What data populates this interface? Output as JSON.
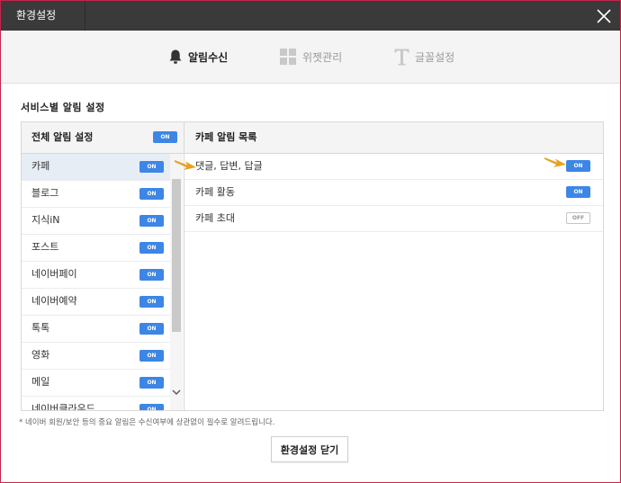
{
  "window": {
    "title": "환경설정"
  },
  "tabs": [
    {
      "label": "알림수신",
      "icon": "bell-icon",
      "active": true
    },
    {
      "label": "위젯관리",
      "icon": "widget-grid-icon",
      "active": false
    },
    {
      "label": "글꼴설정",
      "icon": "font-t-icon",
      "active": false
    }
  ],
  "section_title": "서비스별 알림 설정",
  "left_panel": {
    "header": "전체 알림 설정",
    "header_toggle": "ON",
    "items": [
      {
        "label": "카페",
        "toggle": "ON",
        "selected": true
      },
      {
        "label": "블로그",
        "toggle": "ON"
      },
      {
        "label": "지식iN",
        "toggle": "ON"
      },
      {
        "label": "포스트",
        "toggle": "ON"
      },
      {
        "label": "네이버페이",
        "toggle": "ON"
      },
      {
        "label": "네이버예약",
        "toggle": "ON"
      },
      {
        "label": "톡톡",
        "toggle": "ON"
      },
      {
        "label": "영화",
        "toggle": "ON"
      },
      {
        "label": "메일",
        "toggle": "ON"
      },
      {
        "label": "네이버클라우드",
        "toggle": "ON"
      }
    ]
  },
  "right_panel": {
    "header": "카페 알림 목록",
    "items": [
      {
        "label": "댓글, 답변, 답글",
        "toggle": "ON"
      },
      {
        "label": "카페 활동",
        "toggle": "ON"
      },
      {
        "label": "카페 초대",
        "toggle": "OFF"
      }
    ]
  },
  "note": "* 네이버 회원/보안 등의 중요 알림은 수신여부에 상관없이 필수로 알려드립니다.",
  "footer": {
    "close_label": "환경설정 닫기"
  },
  "colors": {
    "accent": "#3d86e6",
    "titlebar": "#3a3a3a",
    "frame": "#c4254a",
    "arrow": "#e8a21f"
  }
}
